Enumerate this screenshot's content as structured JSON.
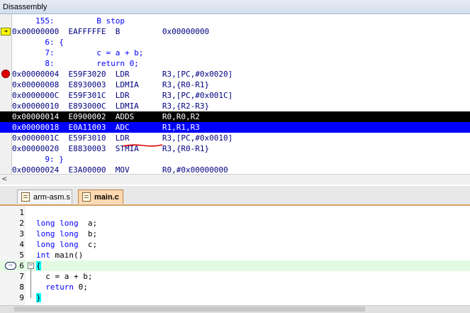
{
  "window": {
    "title": "Disassembly"
  },
  "disassembly": {
    "lines": [
      {
        "text": "     155:         B stop",
        "kind": "src",
        "marker": ""
      },
      {
        "text": "0x00000000  EAFFFFFE  B         0x00000000",
        "kind": "asm",
        "marker": "pc"
      },
      {
        "text": "       6: {",
        "kind": "src",
        "marker": ""
      },
      {
        "text": "       7:         c = a + b;",
        "kind": "src",
        "marker": ""
      },
      {
        "text": "       8:         return 0;",
        "kind": "src",
        "marker": ""
      },
      {
        "text": "0x00000004  E59F3020  LDR       R3,[PC,#0x0020]",
        "kind": "asm",
        "marker": "bp"
      },
      {
        "text": "0x00000008  E8930003  LDMIA     R3,{R0-R1}",
        "kind": "asm",
        "marker": ""
      },
      {
        "text": "0x0000000C  E59F301C  LDR       R3,[PC,#0x001C]",
        "kind": "asm",
        "marker": ""
      },
      {
        "text": "0x00000010  E893000C  LDMIA     R3,{R2-R3}",
        "kind": "asm",
        "marker": ""
      },
      {
        "text": "0x00000014  E0900002  ADDS      R0,R0,R2",
        "kind": "asm",
        "marker": "",
        "highlight": "black"
      },
      {
        "text": "0x00000018  E0A11003  ADC       R1,R1,R3",
        "kind": "asm",
        "marker": "",
        "highlight": "blue"
      },
      {
        "text": "0x0000001C  E59F3010  LDR       R3,[PC,#0x0010]",
        "kind": "asm",
        "marker": ""
      },
      {
        "text": "0x00000020  E8830003  STMIA     R3,{R0-R1}",
        "kind": "asm",
        "marker": ""
      },
      {
        "text": "       9: }",
        "kind": "src",
        "marker": ""
      },
      {
        "text": "0x00000024  E3A00000  MOV       R0,#0x00000000",
        "kind": "asm",
        "marker": ""
      }
    ],
    "scroll_left_arrow": "<"
  },
  "tabs": [
    {
      "label": "arm-asm.s",
      "active": false
    },
    {
      "label": "main.c",
      "active": true
    }
  ],
  "editor": {
    "lines": [
      {
        "num": "1",
        "kw": "",
        "rest": ""
      },
      {
        "num": "2",
        "kw": "long long",
        "rest": "  a;"
      },
      {
        "num": "3",
        "kw": "long long",
        "rest": "  b;"
      },
      {
        "num": "4",
        "kw": "long long",
        "rest": "  c;"
      },
      {
        "num": "5",
        "kw": "int",
        "rest": " main()"
      },
      {
        "num": "6",
        "kw": "",
        "rest": "{"
      },
      {
        "num": "7",
        "kw": "",
        "rest": "  c = a + b;"
      },
      {
        "num": "8",
        "kw": "  return",
        "rest": " 0;"
      },
      {
        "num": "9",
        "kw": "",
        "rest": "}"
      }
    ],
    "current_line": "6",
    "fold_symbol": "−"
  },
  "icons": {
    "pc_arrow": "➔",
    "exec_arrow": "⇨"
  }
}
